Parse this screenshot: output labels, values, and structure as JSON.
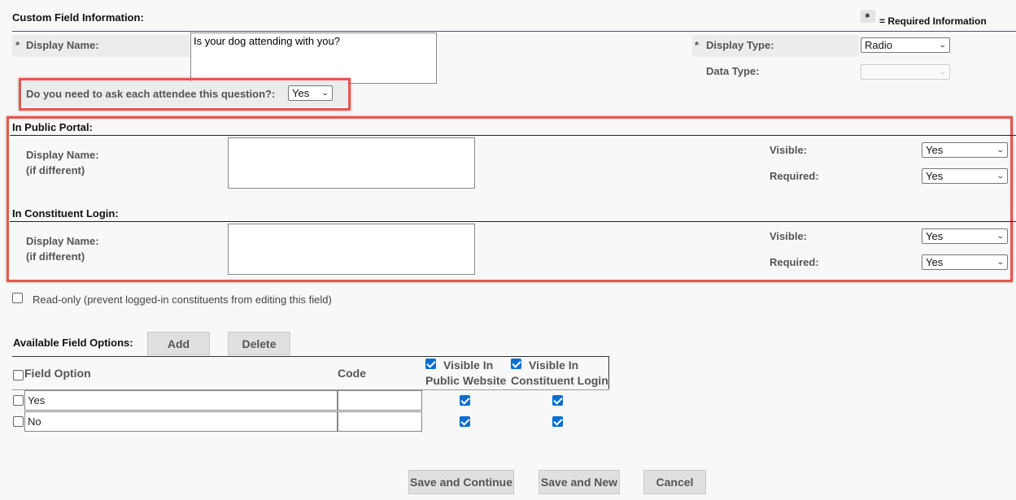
{
  "header": {
    "title": "Custom Field Information:",
    "required_legend": "= Required Information"
  },
  "display_name": {
    "marker": "*",
    "label": "Display Name:",
    "value": "Is your dog attending with you?"
  },
  "display_type": {
    "marker": "*",
    "label": "Display Type:",
    "value": "Radio"
  },
  "data_type": {
    "label": "Data Type:",
    "value": ""
  },
  "ask_each": {
    "label": "Do you need to ask each attendee this question?:",
    "value": "Yes"
  },
  "public_portal": {
    "title": "In Public Portal:",
    "display_name_label_1": "Display Name:",
    "display_name_label_2": "(if different)",
    "display_name_value": "",
    "visible_label": "Visible:",
    "visible_value": "Yes",
    "required_label": "Required:",
    "required_value": "Yes"
  },
  "constituent_login": {
    "title": "In Constituent Login:",
    "display_name_label_1": "Display Name:",
    "display_name_label_2": "(if different)",
    "display_name_value": "",
    "visible_label": "Visible:",
    "visible_value": "Yes",
    "required_label": "Required:",
    "required_value": "Yes"
  },
  "read_only": {
    "label": "Read-only (prevent logged-in constituents from editing this field)",
    "checked": false
  },
  "field_options": {
    "title": "Available Field Options:",
    "add_label": "Add",
    "delete_label": "Delete",
    "columns": {
      "option": "Field Option",
      "code": "Code",
      "visible_public_1": "Visible In",
      "visible_public_2": "Public Website",
      "visible_login_1": "Visible In",
      "visible_login_2": "Constituent Login"
    },
    "rows": [
      {
        "option": "Yes",
        "code": "",
        "public": true,
        "login": true
      },
      {
        "option": "No",
        "code": "",
        "public": true,
        "login": true
      }
    ]
  },
  "footer": {
    "save_continue_label": "Save and Continue",
    "save_new_label": "Save and New",
    "cancel_label": "Cancel"
  }
}
